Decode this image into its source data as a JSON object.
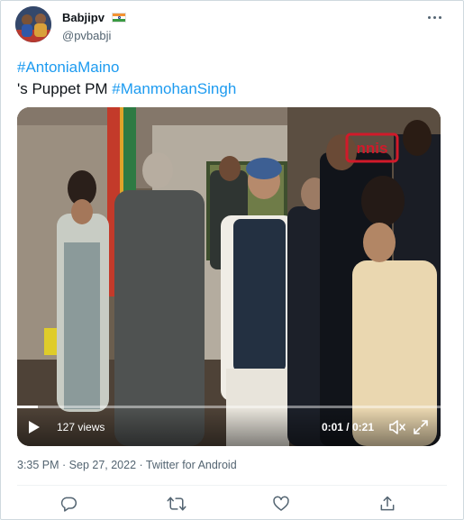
{
  "tweet": {
    "author": {
      "display_name": "Babjipv",
      "handle": "@pvbabji",
      "flag_icon": "india-flag-icon"
    },
    "text": {
      "line1_hashtag": "#AntoniaMaino",
      "line2_prefix": "'s Puppet PM ",
      "line2_hashtag": "#ManmohanSingh"
    },
    "video": {
      "views": "127 views",
      "time": "0:01 / 0:21",
      "progress_fraction": 0.048,
      "watermark": "nnis"
    },
    "meta": "3:35 PM · Sep 27, 2022 · Twitter for Android",
    "actions": [
      "reply-icon",
      "retweet-icon",
      "like-icon",
      "share-icon"
    ]
  },
  "colors": {
    "accent": "#1d9bf0",
    "text": "#0f1419",
    "secondary": "#536471",
    "border": "#cfd9de"
  }
}
